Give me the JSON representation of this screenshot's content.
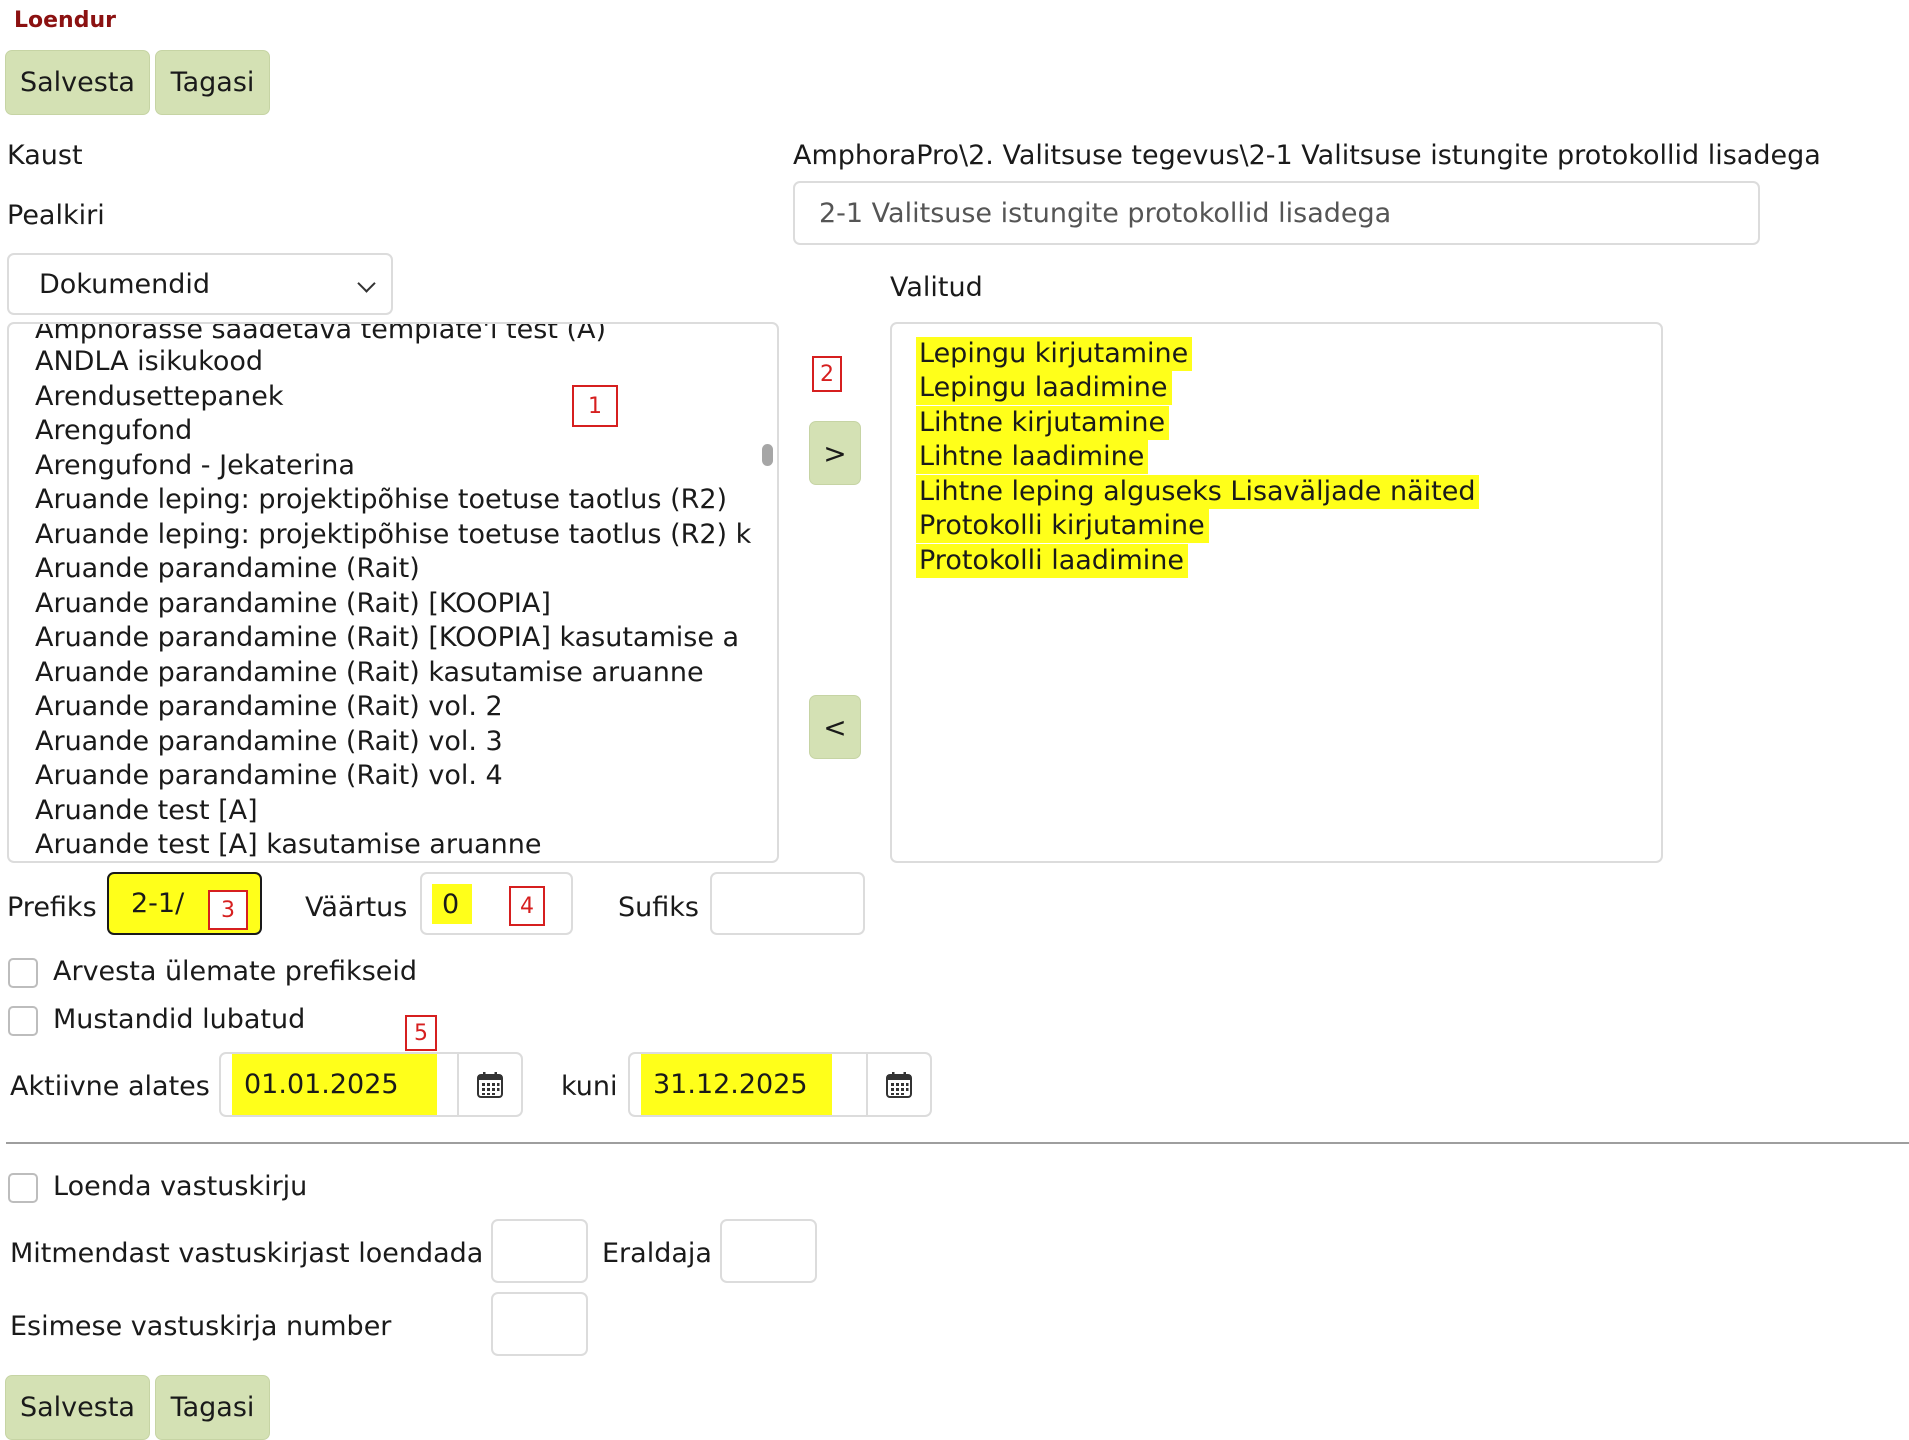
{
  "page": {
    "title": "Loendur"
  },
  "toolbar": {
    "save_label": "Salvesta",
    "back_label": "Tagasi"
  },
  "folder": {
    "label": "Kaust",
    "path": "AmphoraPro\\2. Valitsuse tegevus\\2-1 Valitsuse istungite protokollid lisadega"
  },
  "heading": {
    "label": "Pealkiri",
    "value": "2-1 Valitsuse istungite protokollid lisadega"
  },
  "type_select": {
    "selected": "Dokumendid"
  },
  "available_list": {
    "items": [
      "Amphorasse saadetava template'i test (A)",
      "ANDLA isikukood",
      "Arendusettepanek",
      "Arengufond",
      "Arengufond - Jekaterina",
      "Aruande leping: projektipõhise toetuse taotlus (R2)",
      "Aruande leping: projektipõhise toetuse taotlus (R2) k",
      "Aruande parandamine (Rait)",
      "Aruande parandamine (Rait) [KOOPIA]",
      "Aruande parandamine (Rait) [KOOPIA] kasutamise a",
      "Aruande parandamine (Rait) kasutamise aruanne",
      "Aruande parandamine (Rait) vol. 2",
      "Aruande parandamine (Rait) vol. 3",
      "Aruande parandamine (Rait) vol. 4",
      "Aruande test [A]",
      "Aruande test [A] kasutamise aruanne"
    ]
  },
  "selected_list": {
    "label": "Valitud",
    "items": [
      "Lepingu kirjutamine",
      "Lepingu laadimine",
      "Lihtne kirjutamine",
      "Lihtne laadimine",
      "Lihtne leping alguseks Lisaväljade näited",
      "Protokolli kirjutamine",
      "Protokolli laadimine"
    ]
  },
  "move": {
    "add_label": ">",
    "remove_label": "<"
  },
  "markers": {
    "m1": "1",
    "m2": "2",
    "m3": "3",
    "m4": "4",
    "m5": "5"
  },
  "numbering": {
    "prefix_label": "Prefiks",
    "prefix_value": "2-1/",
    "value_label": "Väärtus",
    "value_value": "0",
    "suffix_label": "Sufiks",
    "suffix_value": ""
  },
  "options": {
    "parent_prefixes_label": "Arvesta ülemate prefikseid",
    "drafts_allowed_label": "Mustandid lubatud"
  },
  "active": {
    "from_label": "Aktiivne alates",
    "from_value": "01.01.2025",
    "to_label": "kuni",
    "to_value": "31.12.2025"
  },
  "replies": {
    "count_replies_label": "Loenda vastuskirju",
    "from_which_label": "Mitmendast vastuskirjast loendada",
    "separator_label": "Eraldaja",
    "first_number_label": "Esimese vastuskirja number"
  },
  "colors": {
    "highlight": "#ffff1a",
    "button": "#d4e1b4",
    "title": "#8b1111",
    "marker": "#d61f1f"
  }
}
